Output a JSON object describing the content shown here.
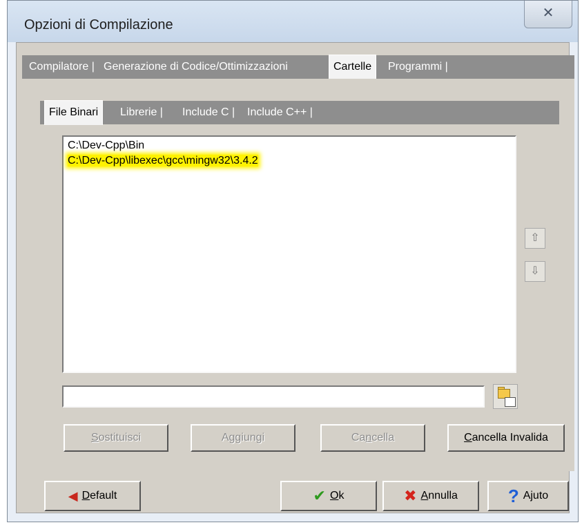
{
  "window": {
    "title": "Opzioni di Compilazione",
    "close_glyph": "✕"
  },
  "tabs": [
    {
      "label": "Compilatore |"
    },
    {
      "label": "Generazione di Codice/Ottimizzazioni"
    },
    {
      "label": "Cartelle"
    },
    {
      "label": "Programmi |"
    }
  ],
  "subtabs": [
    {
      "label": "File Binari"
    },
    {
      "label": "Librerie |"
    },
    {
      "label": "Include C |"
    },
    {
      "label": "Include C++ |"
    }
  ],
  "directories": [
    "C:\\Dev-Cpp\\Bin",
    "C:\\Dev-Cpp\\libexec\\gcc\\mingw32\\3.4.2"
  ],
  "move_up": {
    "icon": "arrow-up-icon",
    "glyph": "⇧"
  },
  "move_down": {
    "icon": "arrow-down-icon",
    "glyph": "⇩"
  },
  "path_input": {
    "value": "",
    "placeholder": ""
  },
  "browse": {
    "icon": "folder-browse-icon"
  },
  "actions": {
    "replace": {
      "mnemonic": "S",
      "rest": "ostituisci"
    },
    "add": {
      "label": "Aggiungi"
    },
    "delete": {
      "before": "Ca",
      "mnemonic": "n",
      "rest": "cella"
    },
    "delete_invalid": {
      "mnemonic": "C",
      "rest": "ancella Invalida"
    }
  },
  "footer": {
    "default": {
      "icon": "red-arrow-left-icon",
      "glyph": "◀",
      "mnemonic": "D",
      "rest": "efault"
    },
    "ok": {
      "icon": "green-check-icon",
      "glyph": "✔",
      "mnemonic": "O",
      "rest": "k"
    },
    "cancel": {
      "icon": "red-x-icon",
      "glyph": "✖",
      "mnemonic": "A",
      "rest": "nnulla"
    },
    "help": {
      "icon": "help-question-icon",
      "glyph": "?",
      "label": "Ajuto"
    }
  },
  "colors": {
    "highlight": "#fff200",
    "tab_bar": "#8e8e8e",
    "dialog_face": "#d4d0c8",
    "ok_green": "#2e9a1e",
    "cancel_red": "#d4241c",
    "help_blue": "#1f5fd6"
  }
}
